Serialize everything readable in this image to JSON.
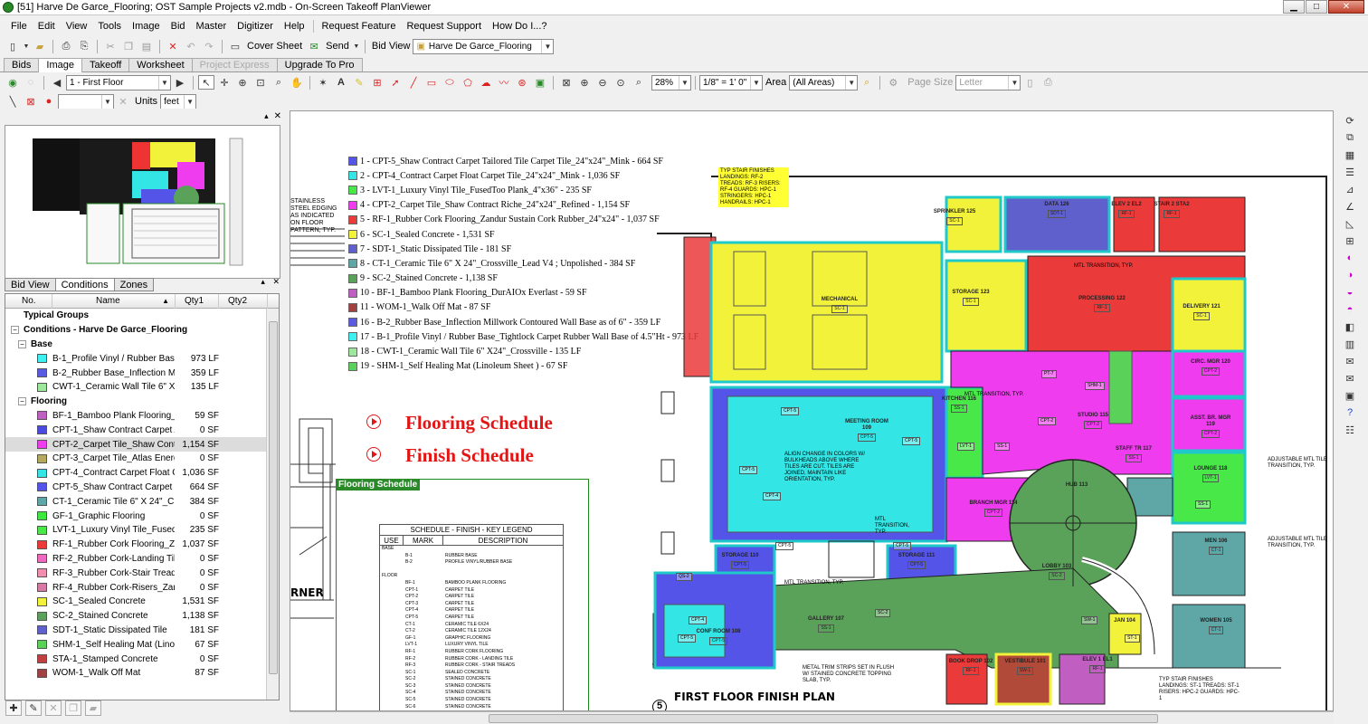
{
  "window": {
    "title": "[51] Harve De Garce_Flooring; OST Sample Projects v2.mdb - On-Screen Takeoff PlanViewer"
  },
  "menu": [
    "File",
    "Edit",
    "View",
    "Tools",
    "Image",
    "Bid",
    "Master",
    "Digitizer",
    "Help",
    "Request Feature",
    "Request Support",
    "How Do I...?"
  ],
  "toolbar1": {
    "cover_sheet": "Cover Sheet",
    "send": "Send",
    "bid_view": "Bid View",
    "bid_name": "Harve De Garce_Flooring"
  },
  "tabs": [
    "Bids",
    "Image",
    "Takeoff",
    "Worksheet",
    "Project Express",
    "Upgrade To Pro"
  ],
  "toolbar2": {
    "page": "1 - First Floor",
    "zoom": "28%",
    "scale": "1/8\" = 1' 0\"",
    "area_label": "Area",
    "area": "(All Areas)",
    "page_size_label": "Page Size",
    "page_size": "Letter"
  },
  "toolbar3": {
    "units_label": "Units",
    "units": "feet"
  },
  "left_tabs": [
    "Bid View",
    "Conditions",
    "Zones"
  ],
  "grid_headers": {
    "no": "No.",
    "name": "Name",
    "qty1": "Qty1",
    "qty2": "Qty2"
  },
  "conditions": {
    "typical": "Typical Groups",
    "root": "Conditions - Harve De Garce_Flooring",
    "base_group": "Base",
    "base": [
      {
        "name": "B-1_Profile Vinyl / Rubber Base_...",
        "qty": "973 LF",
        "color": "#3ff0f0"
      },
      {
        "name": "B-2_Rubber Base_Inflection Mill...",
        "qty": "359 LF",
        "color": "#5a5ae0"
      },
      {
        "name": "CWT-1_Ceramic Wall Tile 6\" X2...",
        "qty": "135 LF",
        "color": "#9de89d"
      }
    ],
    "flooring_group": "Flooring",
    "flooring": [
      {
        "name": "BF-1_Bamboo Plank Flooring_Du...",
        "qty": "59 SF",
        "color": "#c15ec1"
      },
      {
        "name": "CPT-1_Shaw Contract Carpet Aff...",
        "qty": "0 SF",
        "color": "#4a4ae0"
      },
      {
        "name": "CPT-2_Carpet Tile_Shaw Contra...",
        "qty": "1,154 SF",
        "color": "#ee3cee"
      },
      {
        "name": "CPT-3_Carpet Tile_Atlas Energy ...",
        "qty": "0 SF",
        "color": "#b5a95e"
      },
      {
        "name": "CPT-4_Contract Carpet Float Car...",
        "qty": "1,036 SF",
        "color": "#33e5e5"
      },
      {
        "name": "CPT-5_Shaw Contract Carpet Ta...",
        "qty": "664 SF",
        "color": "#5454e8"
      },
      {
        "name": "CT-1_Ceramic Tile 6\" X 24\"_Cro...",
        "qty": "384 SF",
        "color": "#5fa6a6"
      },
      {
        "name": "GF-1_Graphic Flooring",
        "qty": "0 SF",
        "color": "#3ee83e"
      },
      {
        "name": "LVT-1_Luxury Vinyl Tile_FusedT...",
        "qty": "235 SF",
        "color": "#48e848"
      },
      {
        "name": "RF-1_Rubber Cork Flooring_Zan...",
        "qty": "1,037 SF",
        "color": "#ea3a3a"
      },
      {
        "name": "RF-2_Rubber Cork-Landing Tile_...",
        "qty": "0 SF",
        "color": "#f069c0"
      },
      {
        "name": "RF-3_Rubber Cork-Stair Tread_Z...",
        "qty": "0 SF",
        "color": "#f08eb0"
      },
      {
        "name": "RF-4_Rubber Cork-Risers_Zand...",
        "qty": "0 SF",
        "color": "#d67aa5"
      },
      {
        "name": "SC-1_Sealed Concrete",
        "qty": "1,531 SF",
        "color": "#f2f23a"
      },
      {
        "name": "SC-2_Stained Concrete",
        "qty": "1,138 SF",
        "color": "#5aa25a"
      },
      {
        "name": "SDT-1_Static Dissipated Tile",
        "qty": "181 SF",
        "color": "#6060cc"
      },
      {
        "name": "SHM-1_Self Healing Mat (Linoleu...",
        "qty": "67 SF",
        "color": "#5ad25a"
      },
      {
        "name": "STA-1_Stamped Concrete",
        "qty": "0 SF",
        "color": "#c04040"
      },
      {
        "name": "WOM-1_Walk Off Mat",
        "qty": "87 SF",
        "color": "#a04040"
      }
    ]
  },
  "legend": [
    {
      "text": "1 - CPT-5_Shaw Contract Carpet Tailored Tile Carpet Tile_24\"x24\"_Mink - 664 SF",
      "color": "#5454e8"
    },
    {
      "text": "2 - CPT-4_Contract Carpet Float Carpet Tile_24\"x24\"_Mink - 1,036 SF",
      "color": "#33e5e5"
    },
    {
      "text": "3 - LVT-1_Luxury Vinyl Tile_FusedToo Plank_4\"x36\" - 235 SF",
      "color": "#48e848"
    },
    {
      "text": "4 - CPT-2_Carpet Tile_Shaw Contract Riche_24\"x24\"_Refined - 1,154 SF",
      "color": "#ee3cee"
    },
    {
      "text": "5 - RF-1_Rubber Cork Flooring_Zandur Sustain Cork Rubber_24\"x24\" - 1,037 SF",
      "color": "#ea3a3a"
    },
    {
      "text": "6 - SC-1_Sealed Concrete - 1,531 SF",
      "color": "#f2f23a"
    },
    {
      "text": "7 - SDT-1_Static Dissipated Tile - 181 SF",
      "color": "#6060cc"
    },
    {
      "text": "8 - CT-1_Ceramic Tile 6\" X 24\"_Crossville_Lead V4 ; Unpolished - 384 SF",
      "color": "#5fa6a6"
    },
    {
      "text": "9 - SC-2_Stained Concrete - 1,138 SF",
      "color": "#5aa25a"
    },
    {
      "text": "10 - BF-1_Bamboo Plank Flooring_DurAIOx Everlast - 59 SF",
      "color": "#c15ec1"
    },
    {
      "text": "11 - WOM-1_Walk Off Mat - 87 SF",
      "color": "#a04040"
    },
    {
      "text": "16 - B-2_Rubber Base_Inflection Millwork Contoured Wall Base as of 6\" - 359 LF",
      "color": "#5a5ae0"
    },
    {
      "text": "17 - B-1_Profile Vinyl / Rubber Base_Tightlock Carpet Rubber Wall Base of 4.5\"Ht - 973 LF",
      "color": "#3ff0f0"
    },
    {
      "text": "18 - CWT-1_Ceramic Wall Tile 6\" X24\"_Crossville - 135 LF",
      "color": "#9de89d"
    },
    {
      "text": "19 - SHM-1_Self Healing Mat (Linoleum Sheet ) - 67 SF",
      "color": "#5ad25a"
    }
  ],
  "drawing": {
    "flooring_schedule": "Flooring Schedule",
    "finish_schedule": "Finish Schedule",
    "box_label": "Flooring Schedule",
    "key_title": "SCHEDULE - FINISH - KEY LEGEND",
    "key_headers": [
      "USE",
      "MARK",
      "DESCRIPTION"
    ],
    "key_rows": [
      [
        "BASE",
        "",
        ""
      ],
      [
        "",
        "B-1",
        "RUBBER BASE"
      ],
      [
        "",
        "B-2",
        "PROFILE VINYL/RUBBER BASE"
      ],
      [
        "",
        "",
        ""
      ],
      [
        "FLOOR",
        "",
        ""
      ],
      [
        "",
        "BF-1",
        "BAMBOO PLANK FLOORING"
      ],
      [
        "",
        "CPT-1",
        "CARPET TILE"
      ],
      [
        "",
        "CPT-2",
        "CARPET TILE"
      ],
      [
        "",
        "CPT-3",
        "CARPET TILE"
      ],
      [
        "",
        "CPT-4",
        "CARPET TILE"
      ],
      [
        "",
        "CPT-5",
        "CARPET TILE"
      ],
      [
        "",
        "CT-1",
        "CERAMIC TILE 6X24"
      ],
      [
        "",
        "CT-2",
        "CERAMIC TILE 12X24"
      ],
      [
        "",
        "GF-1",
        "GRAPHIC FLOORING"
      ],
      [
        "",
        "LVT-1",
        "LUXURY VINYL TILE"
      ],
      [
        "",
        "RF-1",
        "RUBBER CORK FLOORING"
      ],
      [
        "",
        "RF-2",
        "RUBBER CORK - LANDING TILE"
      ],
      [
        "",
        "RF-3",
        "RUBBER CORK - STAIR TREADS"
      ],
      [
        "",
        "SC-1",
        "SEALED CONCRETE"
      ],
      [
        "",
        "SC-2",
        "STAINED CONCRETE"
      ],
      [
        "",
        "SC-3",
        "STAINED CONCRETE"
      ],
      [
        "",
        "SC-4",
        "STAINED CONCRETE"
      ],
      [
        "",
        "SC-5",
        "STAINED CONCRETE"
      ],
      [
        "",
        "SC-6",
        "STAINED CONCRETE"
      ]
    ],
    "plan_title": "FIRST FLOOR FINISH PLAN",
    "plan_number": "5",
    "corner_text": "RNER",
    "stainless_note": "STAINLESS STEEL EDGING AS INDICATED ON FLOOR PATTERN, TYP.",
    "stair_finishes": "TYP STAIR FINISHES LANDINGS: RF-2 TREADS: RF-3 RISERS: RF-4 GUARDS: HPC-1 STRINGERS: HPC-1 HANDRAILS: HPC-1",
    "stair_finishes2": "TYP STAIR FINISHES LANDINGS: ST-1 TREADS: ST-1 RISERS: HPC-2 GUARDS: HPC-1",
    "adjustable1": "ADJUSTABLE MTL TILE TRANSITION, TYP.",
    "adjustable2": "ADJUSTABLE MTL TILE TRANSITION, TYP.",
    "align_note": "ALIGN CHANGE IN COLORS W/ BULKHEADS ABOVE WHERE TILES ARE CUT. TILES ARE JOINED, MAINTAIN LIKE ORIENTATION, TYP.",
    "metal_trim_note": "METAL TRIM STRIPS SET IN FLUSH W/ STAINED CONCRETE TOPPING SLAB, TYP.",
    "rooms": [
      {
        "id": "mech",
        "label": "MECHANICAL",
        "tag": "SC-1"
      },
      {
        "id": "sprinkler",
        "label": "SPRINKLER 125",
        "tag": "SC-1"
      },
      {
        "id": "data",
        "label": "DATA 126",
        "tag": "SDT-1"
      },
      {
        "id": "elev2",
        "label": "ELEV 2 EL2",
        "tag": "RF-1"
      },
      {
        "id": "stair2",
        "label": "STAIR 2 STA2",
        "tag": "RF-1"
      },
      {
        "id": "storage123",
        "label": "STORAGE 123",
        "tag": "SC-1"
      },
      {
        "id": "processing",
        "label": "PROCESSING 122",
        "tag": "RF-1"
      },
      {
        "id": "delivery",
        "label": "DELIVERY 121",
        "tag": "SC-1"
      },
      {
        "id": "meeting",
        "label": "MEETING ROOM 109",
        "tag": "CPT-5"
      },
      {
        "id": "kitchen",
        "label": "KITCHEN 116",
        "tag": "SS-1"
      },
      {
        "id": "studio",
        "label": "STUDIO 115",
        "tag": "CPT-2"
      },
      {
        "id": "circ",
        "label": "CIRC. MGR 120",
        "tag": "CPT-2"
      },
      {
        "id": "asst",
        "label": "ASST. BR. MGR 119",
        "tag": "CPT-2"
      },
      {
        "id": "staff",
        "label": "STAFF TR 117",
        "tag": "SS-1"
      },
      {
        "id": "lounge",
        "label": "LOUNGE 118",
        "tag": "LVT-1"
      },
      {
        "id": "branch",
        "label": "BRANCH MGR 114",
        "tag": "CPT-2"
      },
      {
        "id": "hub",
        "label": "HUB 113",
        "tag": ""
      },
      {
        "id": "men",
        "label": "MEN 106",
        "tag": "CT-1"
      },
      {
        "id": "women",
        "label": "WOMEN 105",
        "tag": "CT-1"
      },
      {
        "id": "storage110",
        "label": "STORAGE 110",
        "tag": "CPT-5"
      },
      {
        "id": "storage111",
        "label": "STORAGE 111",
        "tag": "CPT-5"
      },
      {
        "id": "lobby",
        "label": "LOBBY 103",
        "tag": "SC-2"
      },
      {
        "id": "gallery",
        "label": "GALLERY 107",
        "tag": "SS-1"
      },
      {
        "id": "conf",
        "label": "CONF ROOM 108",
        "tag": "CPT-5"
      },
      {
        "id": "jan",
        "label": "JAN 104",
        "tag": ""
      },
      {
        "id": "book",
        "label": "BOOK DROP 102",
        "tag": "RF-1"
      },
      {
        "id": "vestibule",
        "label": "VESTIBULE 101",
        "tag": "SW-1"
      },
      {
        "id": "elev1",
        "label": "ELEV 1 EL1",
        "tag": "RF-1"
      }
    ],
    "misc_tags": {
      "cpt4": "CPT-4",
      "cpt5a": "CPT-5",
      "cpt5b": "CPT-5",
      "cpt5c": "CPT-5",
      "cpt5d": "CPT-5",
      "cpt5e": "CPT-5",
      "qs2": "QS-2",
      "cpt4b": "CPT-4",
      "cpt5f": "CPT-5",
      "pt7": "PT-7",
      "shm1": "SHM-1",
      "lvt1": "LVT-1",
      "ss1a": "SS-1",
      "ss1b": "SS-1",
      "cpt2a": "CPT-2",
      "sw1": "SW-1",
      "st1": "ST-1",
      "sc2b": "SC-2",
      "mtl1": "MTL TRANSITION, TYP.",
      "mtl2": "MTL TRANSITION, TYP.",
      "mtl3": "MTL TRANSITION, TYP.",
      "mtl4": "MTL TRANSITION, TYP."
    }
  }
}
